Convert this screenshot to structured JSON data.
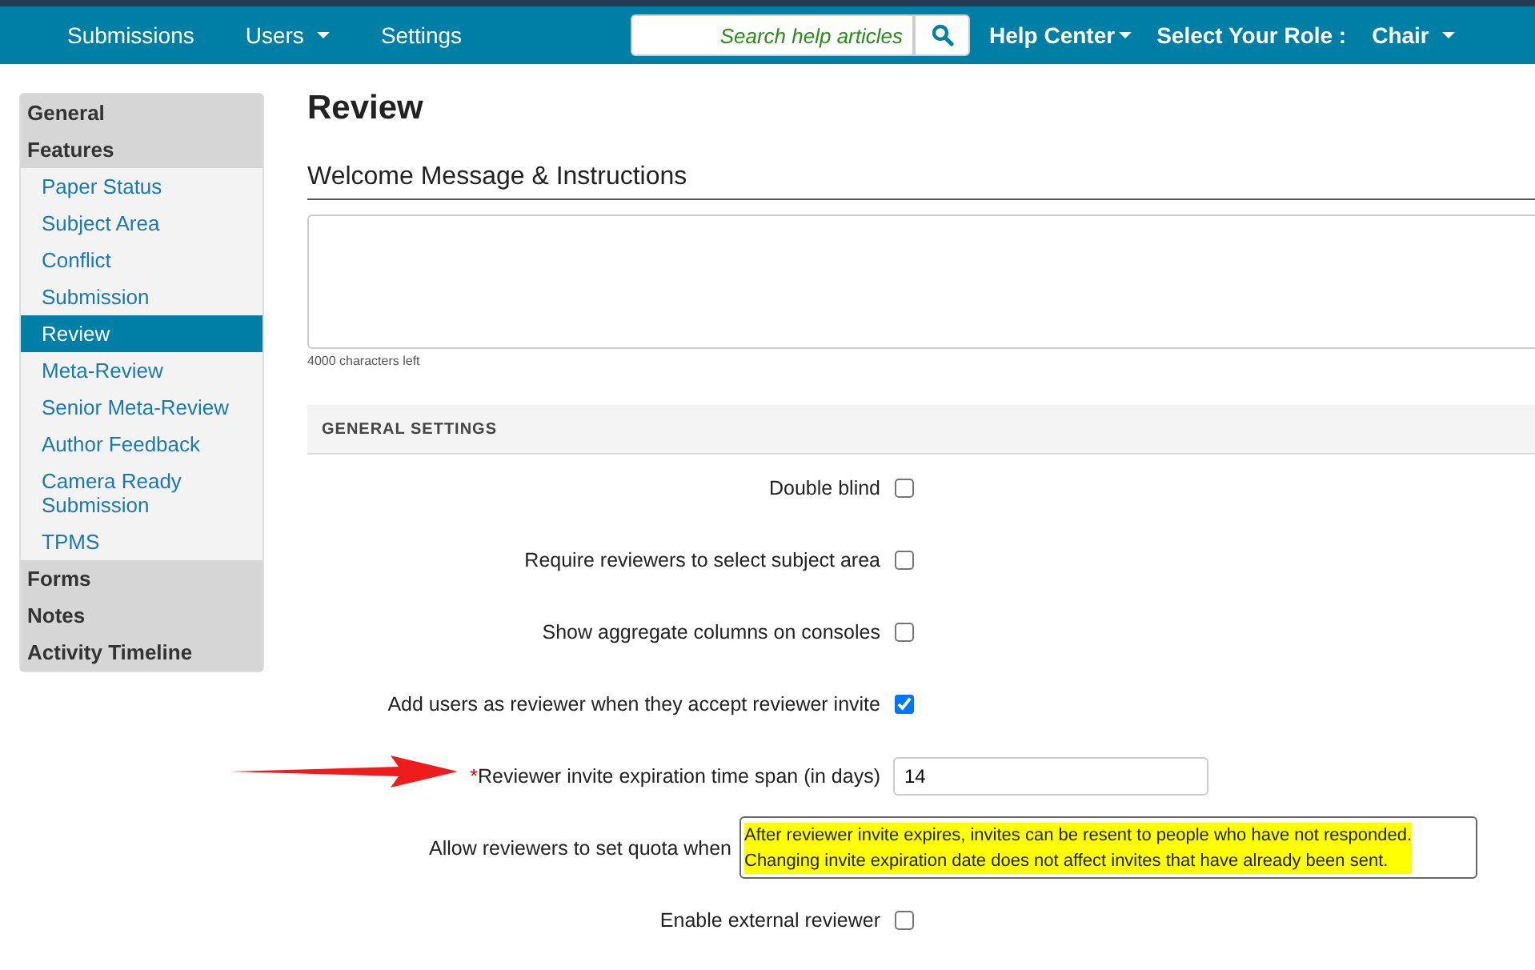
{
  "nav": {
    "links": [
      {
        "label": "Submissions",
        "dropdown": false
      },
      {
        "label": "Users",
        "dropdown": true
      },
      {
        "label": "Settings",
        "dropdown": false
      }
    ],
    "search": {
      "placeholder": "Search help articles"
    },
    "help": "Help Center",
    "role_label": "Select Your Role :",
    "role": "Chair"
  },
  "sidebar": {
    "items": [
      {
        "label": "General",
        "kind": "header",
        "selected": false
      },
      {
        "label": "Features",
        "kind": "header",
        "selected": false
      },
      {
        "label": "Paper Status",
        "kind": "link",
        "selected": false
      },
      {
        "label": "Subject Area",
        "kind": "link",
        "selected": false
      },
      {
        "label": "Conflict",
        "kind": "link",
        "selected": false
      },
      {
        "label": "Submission",
        "kind": "link",
        "selected": false
      },
      {
        "label": "Review",
        "kind": "link",
        "selected": true
      },
      {
        "label": "Meta-Review",
        "kind": "link",
        "selected": false
      },
      {
        "label": "Senior Meta-Review",
        "kind": "link",
        "selected": false
      },
      {
        "label": "Author Feedback",
        "kind": "link",
        "selected": false
      },
      {
        "label": "Camera Ready Submission",
        "kind": "link",
        "selected": false
      },
      {
        "label": "TPMS",
        "kind": "link",
        "selected": false
      },
      {
        "label": "Forms",
        "kind": "header",
        "selected": false
      },
      {
        "label": "Notes",
        "kind": "header",
        "selected": false
      },
      {
        "label": "Activity Timeline",
        "kind": "header",
        "selected": false
      }
    ]
  },
  "page_title": "Review",
  "welcome": {
    "heading": "Welcome Message & Instructions",
    "counter": "4000 characters left"
  },
  "section": "GENERAL SETTINGS",
  "settings": [
    {
      "kind": "checkbox",
      "label": "Double blind",
      "checked": false
    },
    {
      "kind": "checkbox",
      "label": "Require reviewers to select subject area",
      "checked": false
    },
    {
      "kind": "checkbox",
      "label": "Show aggregate columns on consoles",
      "checked": false
    },
    {
      "kind": "checkbox",
      "label": "Add users as reviewer when they accept reviewer invite",
      "checked": true
    },
    {
      "kind": "number",
      "label": "Reviewer invite expiration time span (in days)",
      "required_mark": "*",
      "value": "14"
    },
    {
      "kind": "tooltip",
      "label": "Allow reviewers to set quota when",
      "tooltip": [
        "After reviewer invite expires, invites can be resent to people who have not responded.",
        "Changing invite expiration date does not affect invites that have already been sent."
      ]
    },
    {
      "kind": "checkbox",
      "label": "Enable external reviewer",
      "checked": false
    }
  ]
}
